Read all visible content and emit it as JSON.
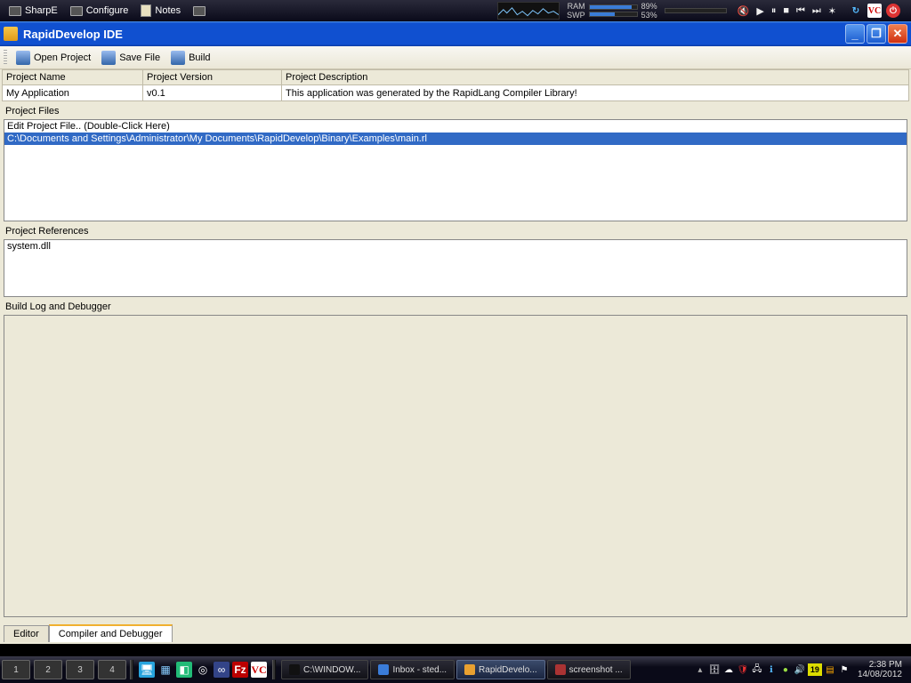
{
  "topbar": {
    "items": [
      "SharpE",
      "Configure",
      "Notes"
    ],
    "ram_label": "RAM",
    "swp_label": "SWP",
    "ram_pct": "89%",
    "swp_pct": "53%",
    "tray": {
      "vc": "VC"
    }
  },
  "window": {
    "title": "RapidDevelop IDE",
    "toolbar": {
      "open": "Open Project",
      "save": "Save File",
      "build": "Build"
    }
  },
  "project": {
    "name_header": "Project Name",
    "version_header": "Project Version",
    "desc_header": "Project Description",
    "name": "My Application",
    "version": "v0.1",
    "description": "This application was generated by the RapidLang Compiler Library!"
  },
  "files": {
    "label": "Project Files",
    "items": [
      "Edit Project File.. (Double-Click Here)",
      "C:\\Documents and Settings\\Administrator\\My Documents\\RapidDevelop\\Binary\\Examples\\main.rl"
    ],
    "selected_index": 1
  },
  "refs": {
    "label": "Project References",
    "items": [
      "system.dll"
    ]
  },
  "buildlog": {
    "label": "Build Log and Debugger"
  },
  "tabs": {
    "editor": "Editor",
    "compiler": "Compiler and Debugger",
    "active_index": 1
  },
  "taskbar": {
    "virtual_desktops": [
      "1",
      "2",
      "3",
      "4"
    ],
    "tasks": [
      {
        "label": "C:\\WINDOW...",
        "active": false
      },
      {
        "label": "Inbox - sted...",
        "active": false
      },
      {
        "label": "RapidDevelo...",
        "active": true
      },
      {
        "label": "screenshot ...",
        "active": false
      }
    ],
    "tray_num": "19",
    "clock_time": "2:38 PM",
    "clock_date": "14/08/2012"
  }
}
